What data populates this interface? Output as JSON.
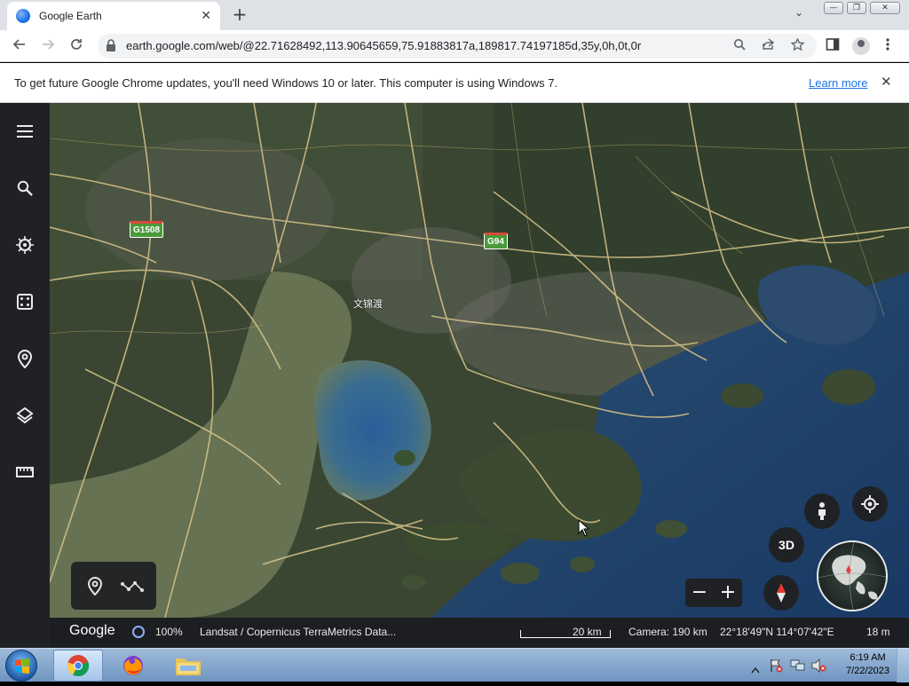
{
  "browser": {
    "tab_title": "Google Earth",
    "tab_close": "✕",
    "new_tab": "+",
    "tab_search": "⌄",
    "url": "earth.google.com/web/@22.71628492,113.90645659,75.91883817a,189817.74197185d,35y,0h,0t,0r",
    "window_controls": {
      "minimize": "—",
      "maximize": "❐",
      "close": "✕"
    }
  },
  "infobar": {
    "message": "To get future Google Chrome updates, you'll need Windows 10 or later. This computer is using Windows 7.",
    "link": "Learn more",
    "close": "✕"
  },
  "rail": {
    "items": [
      {
        "icon": "menu-icon"
      },
      {
        "icon": "search-icon"
      },
      {
        "icon": "voyager-icon"
      },
      {
        "icon": "feeling-lucky-dice-icon"
      },
      {
        "icon": "projects-pin-icon"
      },
      {
        "icon": "layers-icon"
      },
      {
        "icon": "ruler-icon"
      }
    ]
  },
  "map": {
    "shields": [
      "G1508",
      "G94"
    ],
    "place_label": "文锦渡",
    "colors": {
      "land": "#33402e",
      "water_deep": "#1d3e6e",
      "water_shallow": "#4a6b7a",
      "road": "#d9c58a",
      "estuary": "#6e7a58"
    }
  },
  "controls": {
    "btn_3d": "3D",
    "zoom_out": "−",
    "zoom_in": "+"
  },
  "status": {
    "logo": "Google",
    "loading": "100%",
    "attribution": "Landsat / Copernicus   TerraMetrics   Data...",
    "scale": "20 km",
    "camera": "Camera: 190 km",
    "coords": "22°18'49\"N 114°07'42\"E",
    "elevation": "18 m"
  },
  "taskbar": {
    "time": "6:19 AM",
    "date": "7/22/2023"
  }
}
